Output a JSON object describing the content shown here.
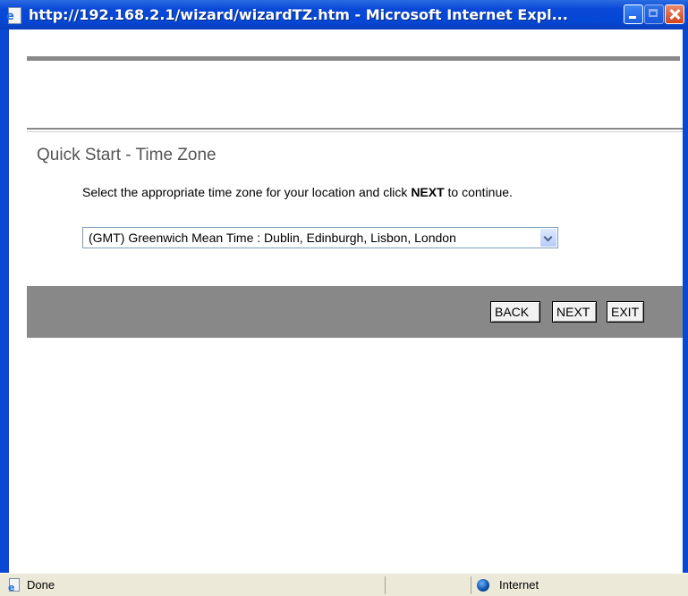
{
  "window": {
    "title": "http://192.168.2.1/wizard/wizardTZ.htm - Microsoft Internet Expl...",
    "icon": "ie-page-icon",
    "controls": [
      "minimize-icon",
      "maximize-icon",
      "close-icon"
    ]
  },
  "page": {
    "section_title": "Quick Start - Time Zone",
    "instruction_pre": "Select the appropriate time zone for your location and click ",
    "instruction_bold": "NEXT",
    "instruction_post": " to continue.",
    "timezone_select": {
      "selected": "(GMT) Greenwich Mean Time : Dublin, Edinburgh, Lisbon, London"
    },
    "buttons": {
      "back": "BACK",
      "next": "NEXT",
      "exit": "EXIT"
    }
  },
  "statusbar": {
    "status": "Done",
    "zone": "Internet"
  },
  "colors": {
    "titlebar": "#0548d6",
    "bar_gray": "#888888",
    "heading": "#555555",
    "statusbar": "#ece9d8"
  }
}
